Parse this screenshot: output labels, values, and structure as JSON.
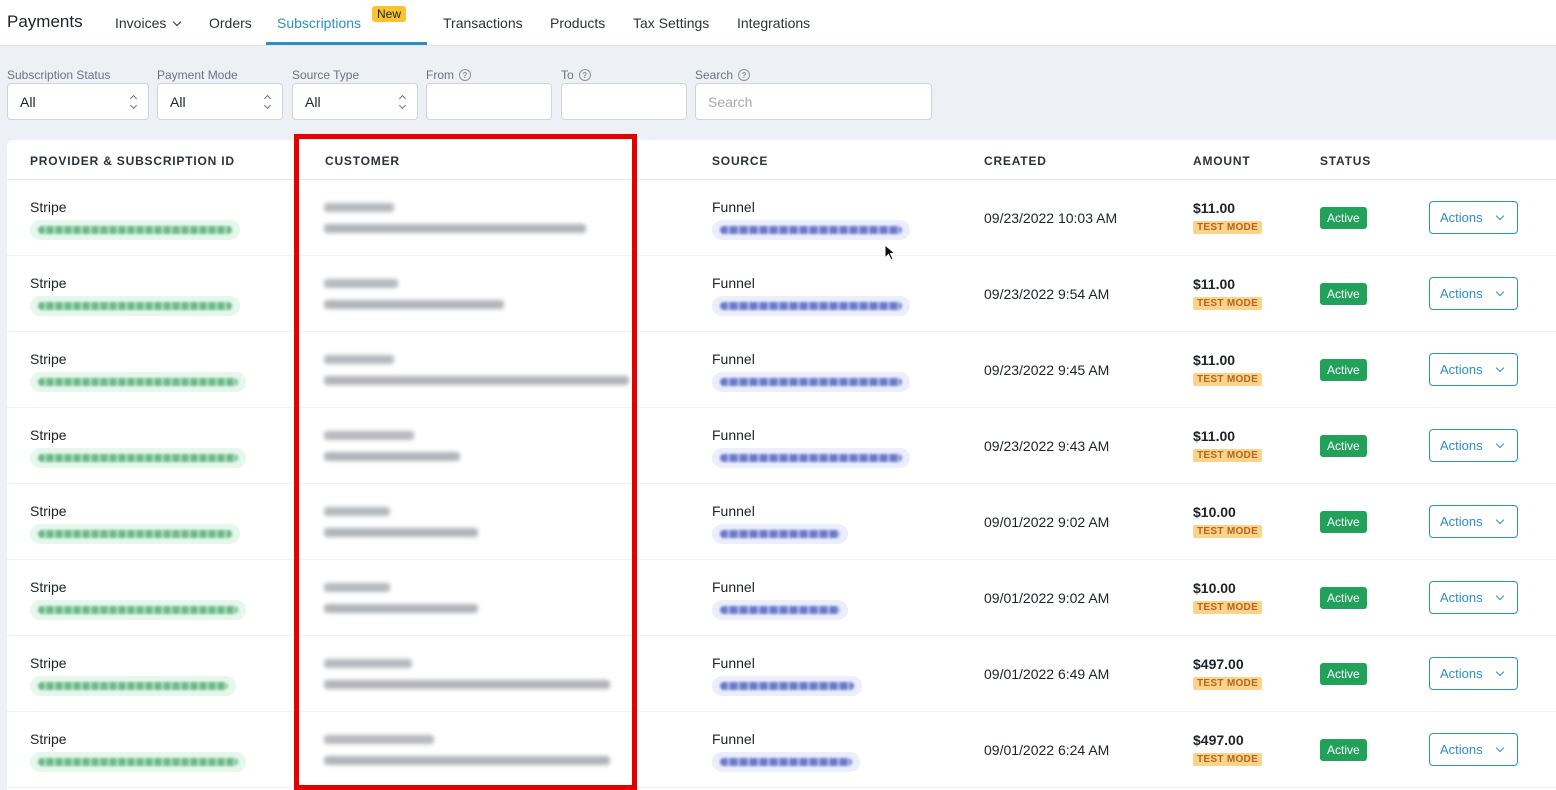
{
  "nav": {
    "brand": "Payments",
    "items": [
      "Invoices",
      "Orders",
      "Subscriptions",
      "Transactions",
      "Products",
      "Tax Settings",
      "Integrations"
    ],
    "new_badge": "New",
    "active": "Subscriptions"
  },
  "filters": {
    "subscription_status": {
      "label": "Subscription Status",
      "value": "All"
    },
    "payment_mode": {
      "label": "Payment Mode",
      "value": "All"
    },
    "source_type": {
      "label": "Source Type",
      "value": "All"
    },
    "from": {
      "label": "From",
      "value": ""
    },
    "to": {
      "label": "To",
      "value": ""
    },
    "search": {
      "label": "Search",
      "placeholder": "Search",
      "value": ""
    }
  },
  "table": {
    "headers": [
      "PROVIDER & SUBSCRIPTION ID",
      "CUSTOMER",
      "SOURCE",
      "CREATED",
      "AMOUNT",
      "STATUS"
    ],
    "rows": [
      {
        "provider": "Stripe",
        "source": "Funnel",
        "created": "09/23/2022 10:03 AM",
        "amount": "$11.00",
        "mode": "TEST MODE",
        "status": "Active",
        "action": "Actions"
      },
      {
        "provider": "Stripe",
        "source": "Funnel",
        "created": "09/23/2022 9:54 AM",
        "amount": "$11.00",
        "mode": "TEST MODE",
        "status": "Active",
        "action": "Actions"
      },
      {
        "provider": "Stripe",
        "source": "Funnel",
        "created": "09/23/2022 9:45 AM",
        "amount": "$11.00",
        "mode": "TEST MODE",
        "status": "Active",
        "action": "Actions"
      },
      {
        "provider": "Stripe",
        "source": "Funnel",
        "created": "09/23/2022 9:43 AM",
        "amount": "$11.00",
        "mode": "TEST MODE",
        "status": "Active",
        "action": "Actions"
      },
      {
        "provider": "Stripe",
        "source": "Funnel",
        "created": "09/01/2022 9:02 AM",
        "amount": "$10.00",
        "mode": "TEST MODE",
        "status": "Active",
        "action": "Actions"
      },
      {
        "provider": "Stripe",
        "source": "Funnel",
        "created": "09/01/2022 9:02 AM",
        "amount": "$10.00",
        "mode": "TEST MODE",
        "status": "Active",
        "action": "Actions"
      },
      {
        "provider": "Stripe",
        "source": "Funnel",
        "created": "09/01/2022 6:49 AM",
        "amount": "$497.00",
        "mode": "TEST MODE",
        "status": "Active",
        "action": "Actions"
      },
      {
        "provider": "Stripe",
        "source": "Funnel",
        "created": "09/01/2022 6:24 AM",
        "amount": "$497.00",
        "mode": "TEST MODE",
        "status": "Active",
        "action": "Actions"
      }
    ]
  },
  "colors": {
    "accent": "#2e8ec5",
    "active_green": "#22a15a",
    "test_mode_bg": "#fbd38d",
    "highlight_red": "#e30000"
  }
}
